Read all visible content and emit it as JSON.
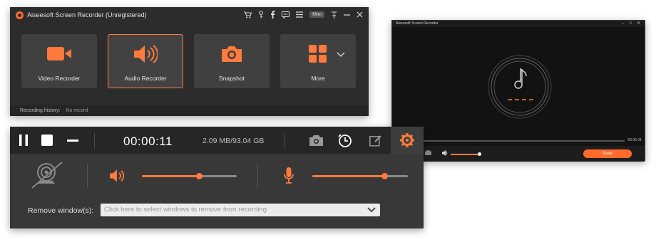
{
  "main_window": {
    "title": "Aiseesoft Screen Recorder (Unregistered)",
    "mini_label": "Mini",
    "tiles": [
      {
        "label": "Video Recorder",
        "icon": "video-camera-icon",
        "active": false
      },
      {
        "label": "Audio Recorder",
        "icon": "speaker-icon",
        "active": true
      },
      {
        "label": "Snapshot",
        "icon": "camera-icon",
        "active": false
      },
      {
        "label": "More",
        "icon": "grid-icon",
        "active": false
      }
    ],
    "history_label": "Recording history:",
    "history_value": "No record"
  },
  "player_window": {
    "title": "Aiseesoft Screen Recorder",
    "time": "00:00:31",
    "save_label": "Save"
  },
  "recording_panel": {
    "timer": "00:00:11",
    "file_size": "2.09 MB/93.04 GB",
    "system_volume_level": 0.6,
    "mic_volume_level": 0.75,
    "remove_window_label": "Remove window(s):",
    "remove_window_placeholder": "Click here to select windows to remove from recording"
  },
  "colors": {
    "accent": "#ff7a3c",
    "window_bg": "#2c2c2c",
    "tile_bg": "#404040",
    "toolbar_bg": "#262626"
  }
}
